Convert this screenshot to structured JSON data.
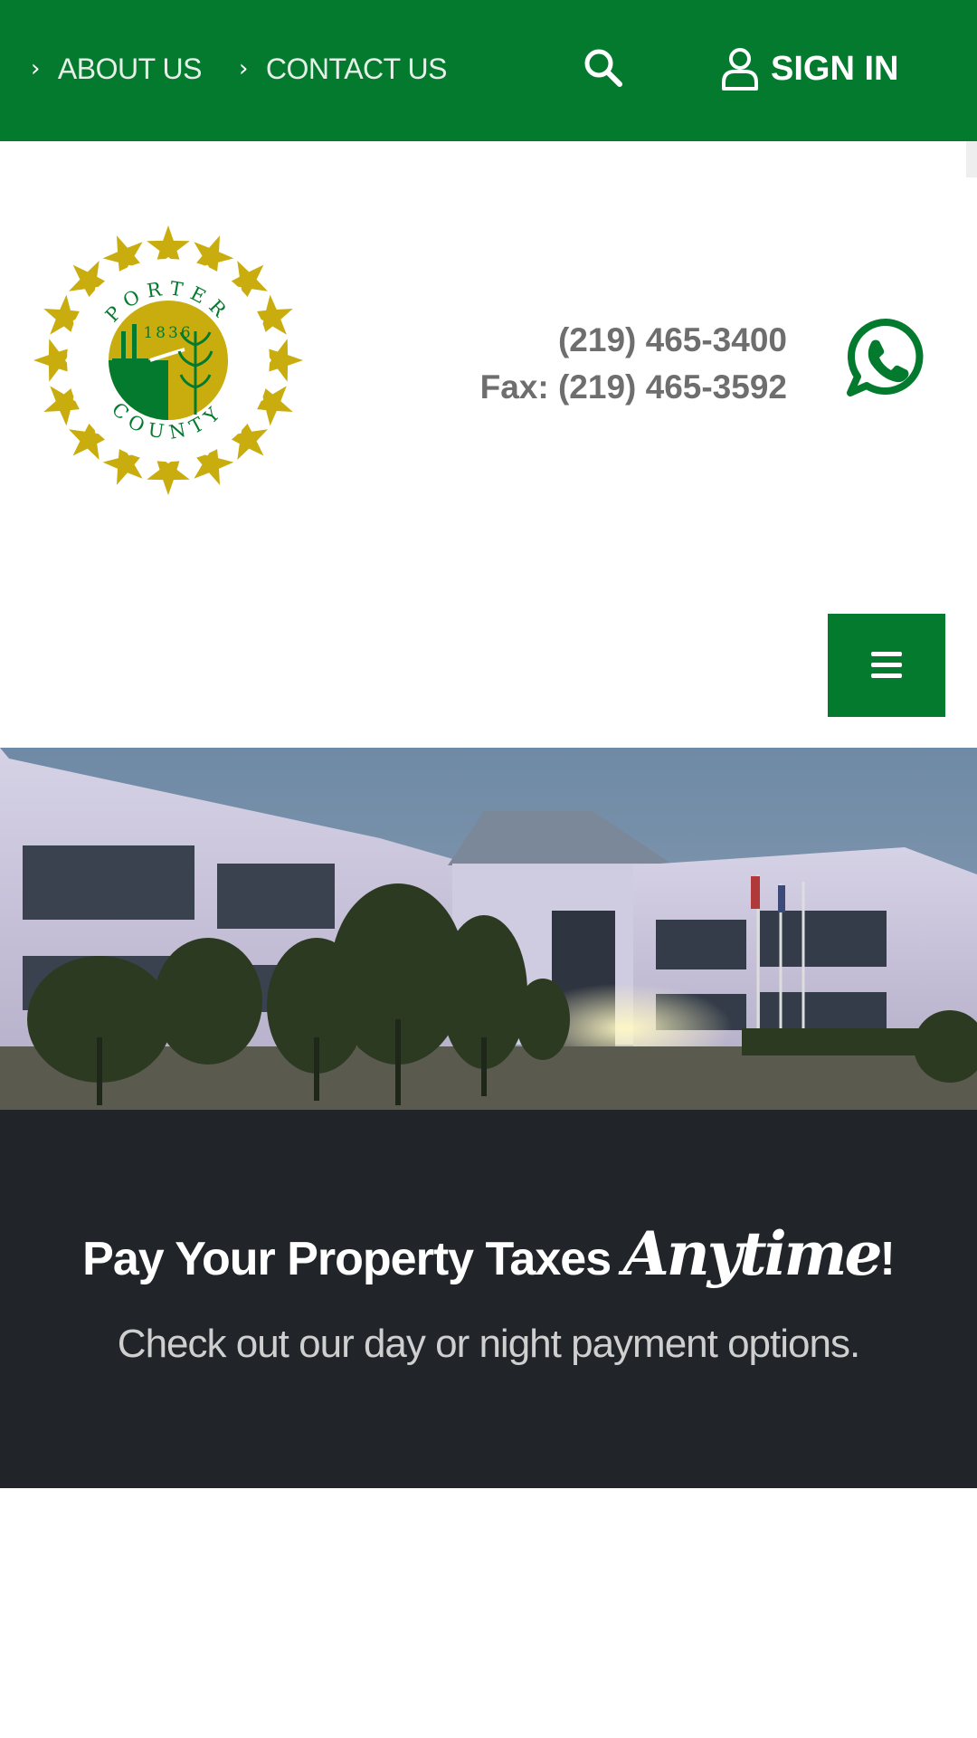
{
  "topbar": {
    "nav": [
      {
        "label": "ABOUT US"
      },
      {
        "label": "CONTACT US"
      }
    ],
    "sign_in_label": "SIGN IN"
  },
  "header": {
    "logo": {
      "top_text": "PORTER",
      "year": "1836",
      "bottom_text": "COUNTY"
    },
    "phone": "(219) 465-3400",
    "fax": "Fax: (219) 465-3592"
  },
  "promo": {
    "title_main": "Pay Your Property Taxes ",
    "title_script": "Anytime",
    "title_end": "!",
    "subtitle": "Check out our day or night payment options."
  },
  "colors": {
    "brand_green": "#047a2e",
    "gold": "#c9ad0e",
    "dark_band": "#212428"
  },
  "icons": [
    "chevron-right-icon",
    "search-icon",
    "user-icon",
    "whatsapp-icon",
    "hamburger-menu-icon"
  ]
}
